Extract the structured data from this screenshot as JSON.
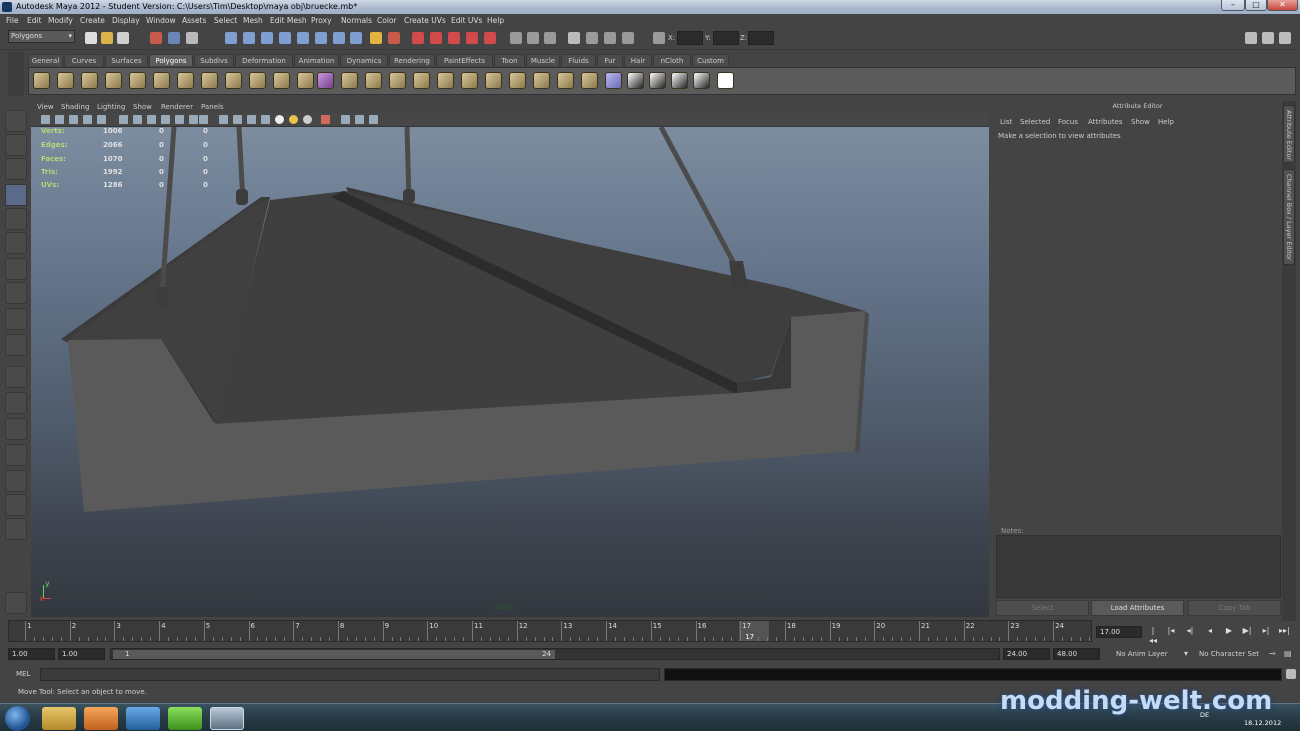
{
  "window": {
    "title": "Autodesk Maya 2012 - Student Version: C:\\Users\\Tim\\Desktop\\maya obj\\bruecke.mb*",
    "minimize": "–",
    "maximize": "□",
    "close": "✕"
  },
  "menubar": [
    "File",
    "Edit",
    "Modify",
    "Create",
    "Display",
    "Window",
    "Assets",
    "Select",
    "Mesh",
    "Edit Mesh",
    "Proxy",
    "Normals",
    "Color",
    "Create UVs",
    "Edit UVs",
    "Help"
  ],
  "statusline": {
    "mode": "Polygons",
    "x_label": "X:",
    "y_label": "Y:",
    "z_label": "Z:"
  },
  "shelf": {
    "tabs": [
      "General",
      "Curves",
      "Surfaces",
      "Polygons",
      "Subdivs",
      "Deformation",
      "Animation",
      "Dynamics",
      "Rendering",
      "PaintEffects",
      "Toon",
      "Muscle",
      "Fluids",
      "Fur",
      "Hair",
      "nCloth",
      "Custom"
    ],
    "active_tab": "Polygons"
  },
  "viewport": {
    "menu": [
      "View",
      "Shading",
      "Lighting",
      "Show",
      "Renderer",
      "Panels"
    ],
    "camera_label": "persp",
    "heads_up": [
      {
        "label": "Verts:",
        "v1": "1006",
        "v2": "0",
        "v3": "0"
      },
      {
        "label": "Edges:",
        "v1": "2066",
        "v2": "0",
        "v3": "0"
      },
      {
        "label": "Faces:",
        "v1": "1070",
        "v2": "0",
        "v3": "0"
      },
      {
        "label": "Tris:",
        "v1": "1992",
        "v2": "0",
        "v3": "0"
      },
      {
        "label": "UVs:",
        "v1": "1286",
        "v2": "0",
        "v3": "0"
      }
    ],
    "axis": {
      "x": "x",
      "y": "y"
    }
  },
  "attribute_editor": {
    "title": "Attribute Editor",
    "menu": [
      "List",
      "Selected",
      "Focus",
      "Attributes",
      "Show",
      "Help"
    ],
    "message": "Make a selection to view attributes",
    "notes_label": "Notes:",
    "buttons": {
      "select": "Select",
      "load": "Load Attributes",
      "copy": "Copy Tab"
    }
  },
  "side_tabs": {
    "attribute_editor": "Attribute Editor",
    "channel_box": "Channel Box / Layer Editor"
  },
  "timeline": {
    "ticks": [
      "1",
      "2",
      "3",
      "4",
      "5",
      "6",
      "7",
      "8",
      "9",
      "10",
      "11",
      "12",
      "13",
      "14",
      "15",
      "16",
      "17",
      "18",
      "19",
      "20",
      "21",
      "22",
      "23",
      "24"
    ],
    "current_frame": "17",
    "current_field": "17.00",
    "buttons": [
      "|◂◂",
      "|◂",
      "◂|",
      "◂",
      "▶",
      "▶|",
      "▸|",
      "▸▸|"
    ]
  },
  "range": {
    "start": "1.00",
    "start2": "1.00",
    "handle_start": "1",
    "handle_end": "24",
    "end": "24.00",
    "end2": "48.00",
    "anim_layer": "No Anim Layer",
    "character_set": "No Character Set"
  },
  "command": {
    "label": "MEL"
  },
  "helpline": "Move Tool: Select an object to move.",
  "taskbar": {
    "watermark": "modding-welt.com",
    "lang": "DE",
    "time": "18:12.2012",
    "date": "18.12.2012"
  },
  "colors": {
    "ui_bg": "#444444",
    "viewport_top": "#7c8da0",
    "viewport_bottom": "#33383f",
    "hud_label": "#b7d77a",
    "mesh_top": "#3d3d3d",
    "mesh_side": "#5b5b5b"
  }
}
